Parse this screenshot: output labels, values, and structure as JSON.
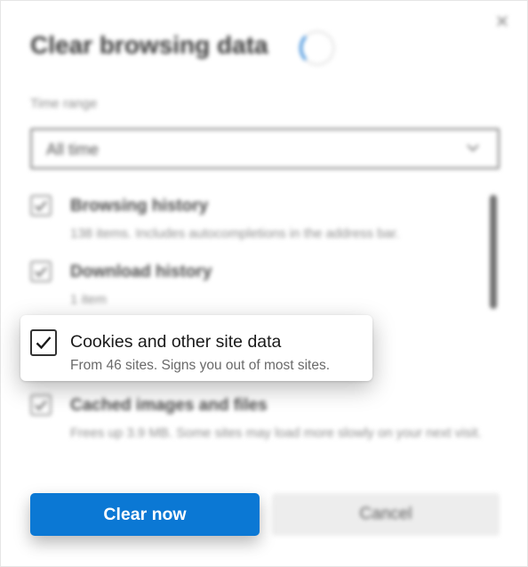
{
  "dialog": {
    "title": "Clear browsing data",
    "close_glyph": "✕",
    "time_range": {
      "label": "Time range",
      "value": "All time"
    },
    "items": [
      {
        "title": "Browsing history",
        "description": "138 items. Includes autocompletions in the address bar.",
        "checked": true
      },
      {
        "title": "Download history",
        "description": "1 item",
        "checked": true
      },
      {
        "title": "Cookies and other site data",
        "description": "From 46 sites. Signs you out of most sites.",
        "checked": true
      },
      {
        "title": "Cached images and files",
        "description": "Frees up 3.9 MB. Some sites may load more slowly on your next visit.",
        "checked": true
      }
    ],
    "buttons": {
      "clear_label": "Clear now",
      "cancel_label": "Cancel"
    },
    "colors": {
      "accent": "#0b78d4",
      "spinner": "#2f86d8"
    }
  }
}
